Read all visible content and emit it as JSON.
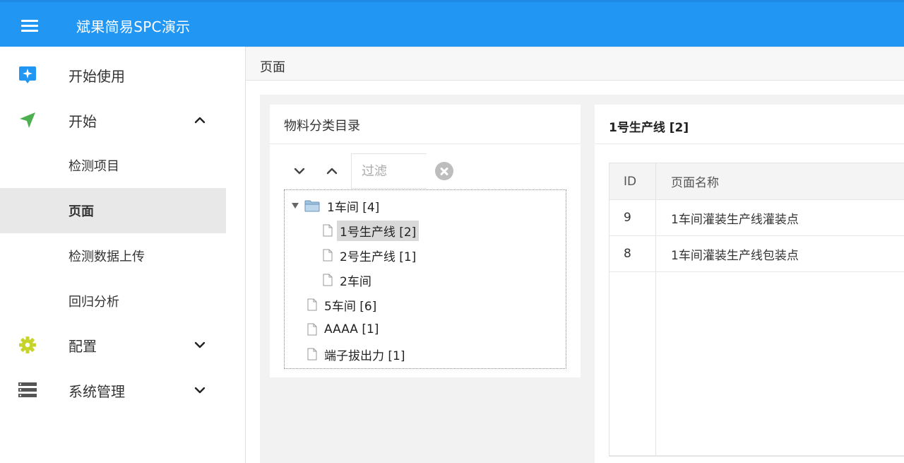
{
  "header": {
    "title": "斌果简易SPC演示"
  },
  "sidebar": {
    "items": [
      {
        "label": "开始使用",
        "icon": "sparkle-badge-icon"
      },
      {
        "label": "开始",
        "icon": "send-arrow-icon",
        "expanded": true,
        "children": [
          {
            "label": "检测项目"
          },
          {
            "label": "页面",
            "active": true
          },
          {
            "label": "检测数据上传"
          },
          {
            "label": "回归分析"
          }
        ]
      },
      {
        "label": "配置",
        "icon": "gear-icon",
        "expanded": false
      },
      {
        "label": "系统管理",
        "icon": "server-rack-icon",
        "expanded": false
      }
    ]
  },
  "breadcrumb": "页面",
  "category_panel": {
    "title": "物料分类目录",
    "filter_placeholder": "过滤",
    "tree": [
      {
        "label": "1车间 [4]",
        "type": "folder",
        "expanded": true,
        "children": [
          {
            "label": "1号生产线 [2]",
            "type": "file",
            "selected": true
          },
          {
            "label": "2号生产线 [1]",
            "type": "file"
          },
          {
            "label": "2车间",
            "type": "file"
          }
        ]
      },
      {
        "label": "5车间 [6]",
        "type": "file"
      },
      {
        "label": "AAAA [1]",
        "type": "file"
      },
      {
        "label": "端子拔出力 [1]",
        "type": "file"
      }
    ]
  },
  "detail_panel": {
    "title": "1号生产线 [2]",
    "columns": [
      "ID",
      "页面名称"
    ],
    "rows": [
      {
        "id": "9",
        "name": "1车间灌装生产线灌装点"
      },
      {
        "id": "8",
        "name": "1车间灌装生产线包装点"
      }
    ]
  },
  "colors": {
    "primary": "#2196f3",
    "accent_green": "#4caf50",
    "gear_yellow": "#c6d42a"
  }
}
